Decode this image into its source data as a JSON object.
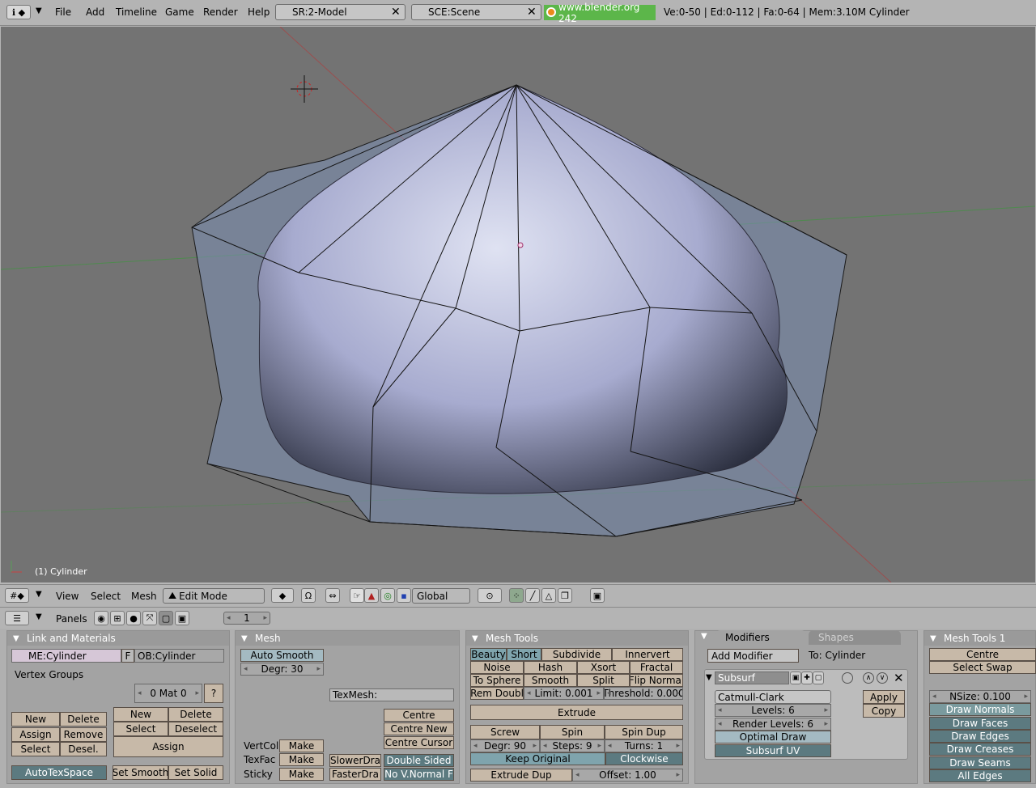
{
  "topbar": {
    "menus": [
      "File",
      "Add",
      "Timeline",
      "Game",
      "Render",
      "Help"
    ],
    "screen": "SR:2-Model",
    "scene": "SCE:Scene",
    "site": "www.blender.org 242",
    "stats": "Ve:0-50 | Ed:0-112 | Fa:0-64 | Mem:3.10M Cylinder"
  },
  "viewport": {
    "object_label": "(1) Cylinder"
  },
  "view3d_header": {
    "menus": [
      "View",
      "Select",
      "Mesh"
    ],
    "mode": "Edit Mode",
    "orientation": "Global"
  },
  "buttons_header": {
    "label": "Panels",
    "frame": "1"
  },
  "link_materials": {
    "title": "Link and Materials",
    "mesh_name": "ME:Cylinder",
    "f_label": "F",
    "object_name": "OB:Cylinder",
    "vertex_groups": "Vertex Groups",
    "mat": "0 Mat 0",
    "help": "?",
    "vg_buttons": [
      "New",
      "Delete",
      "Assign",
      "Remove",
      "Select",
      "Desel."
    ],
    "mat_buttons": [
      "New",
      "Delete",
      "Select",
      "Deselect"
    ],
    "assign": "Assign",
    "autotex": "AutoTexSpace",
    "set_smooth": "Set Smooth",
    "set_solid": "Set Solid"
  },
  "mesh": {
    "title": "Mesh",
    "auto_smooth": "Auto Smooth",
    "degr": "Degr: 30",
    "texmesh": "TexMesh:",
    "centre": "Centre",
    "centre_new": "Centre New",
    "centre_cursor": "Centre Cursor",
    "vertcol": "VertCol",
    "texfac": "TexFac",
    "sticky": "Sticky",
    "make": "Make",
    "slower": "SlowerDra",
    "faster": "FasterDra",
    "double_sided": "Double Sided",
    "no_vnormal": "No V.Normal F"
  },
  "mesh_tools": {
    "title": "Mesh Tools",
    "beauty": "Beauty",
    "short": "Short",
    "subdivide": "Subdivide",
    "innervert": "Innervert",
    "noise": "Noise",
    "hash": "Hash",
    "xsort": "Xsort",
    "fractal": "Fractal",
    "to_sphere": "To Sphere",
    "smooth": "Smooth",
    "split": "Split",
    "flip_normal": "Flip Normal",
    "rem_doubl": "Rem Doubl",
    "limit": "Limit: 0.001",
    "threshold": "Threshold: 0.000",
    "extrude": "Extrude",
    "screw": "Screw",
    "spin": "Spin",
    "spin_dup": "Spin Dup",
    "degr": "Degr: 90",
    "steps": "Steps: 9",
    "turns": "Turns: 1",
    "keep_original": "Keep Original",
    "clockwise": "Clockwise",
    "extrude_dup": "Extrude Dup",
    "offset": "Offset: 1.00"
  },
  "modifiers": {
    "tab_modifiers": "Modifiers",
    "tab_shapes": "Shapes",
    "add_modifier": "Add Modifier",
    "to": "To: Cylinder",
    "name": "Subsurf",
    "type": "Catmull-Clark",
    "levels": "Levels: 6",
    "render_levels": "Render Levels: 6",
    "optimal_draw": "Optimal Draw",
    "subsurf_uv": "Subsurf UV",
    "apply": "Apply",
    "copy": "Copy"
  },
  "mesh_tools1": {
    "title": "Mesh Tools 1",
    "centre": "Centre",
    "select_swap": "Select Swap",
    "nsize": "NSize: 0.100",
    "draw_normals": "Draw Normals",
    "draw_faces": "Draw Faces",
    "draw_edges": "Draw Edges",
    "draw_creases": "Draw Creases",
    "draw_seams": "Draw Seams",
    "all_edges": "All Edges"
  }
}
